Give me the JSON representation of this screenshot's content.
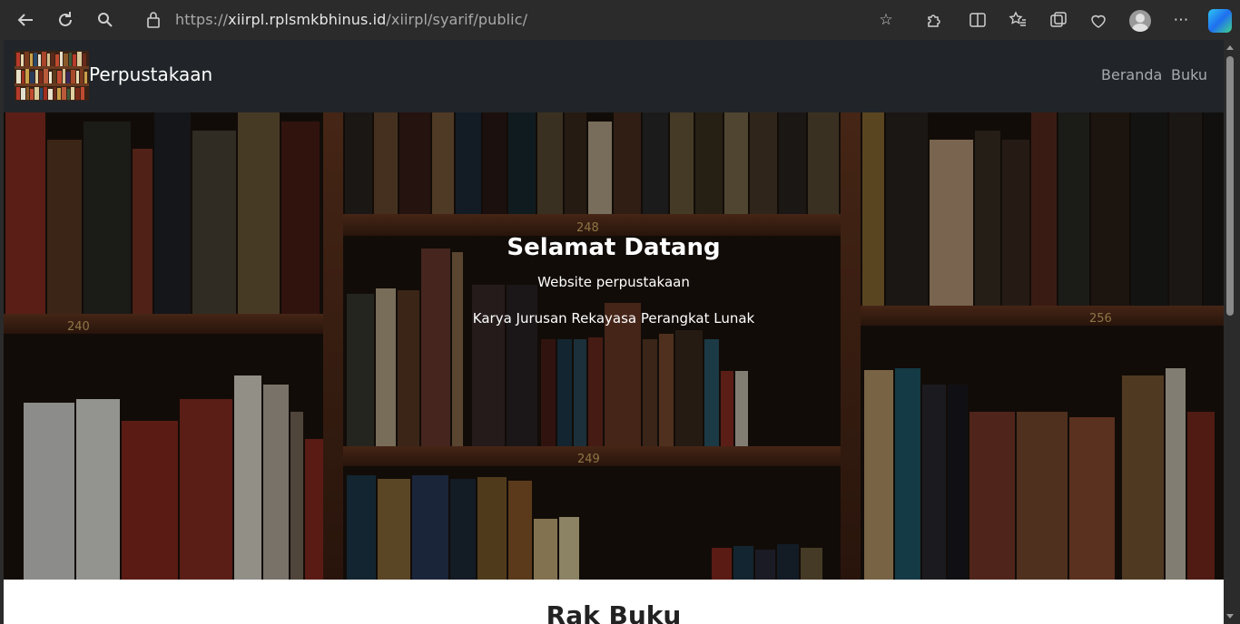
{
  "browser": {
    "url_scheme": "https://",
    "url_host": "xiirpl.rplsmkbhinus.id",
    "url_path": "/xiirpl/syarif/public/"
  },
  "site": {
    "brand": "Perpustakaan",
    "nav": [
      {
        "label": "Beranda"
      },
      {
        "label": "Buku"
      }
    ]
  },
  "hero": {
    "title": "Selamat Datang",
    "subtitle": "Website perpustakaan",
    "credit": "Karya Jurusan Rekayasa Perangkat Lunak",
    "shelf_labels": [
      "248",
      "240",
      "256",
      "249"
    ]
  },
  "section": {
    "title": "Rak Buku"
  },
  "colors": {
    "navbar": "#212529",
    "nav_link": "#a6a9ad",
    "shelf_wood": "#5a2e1a"
  }
}
